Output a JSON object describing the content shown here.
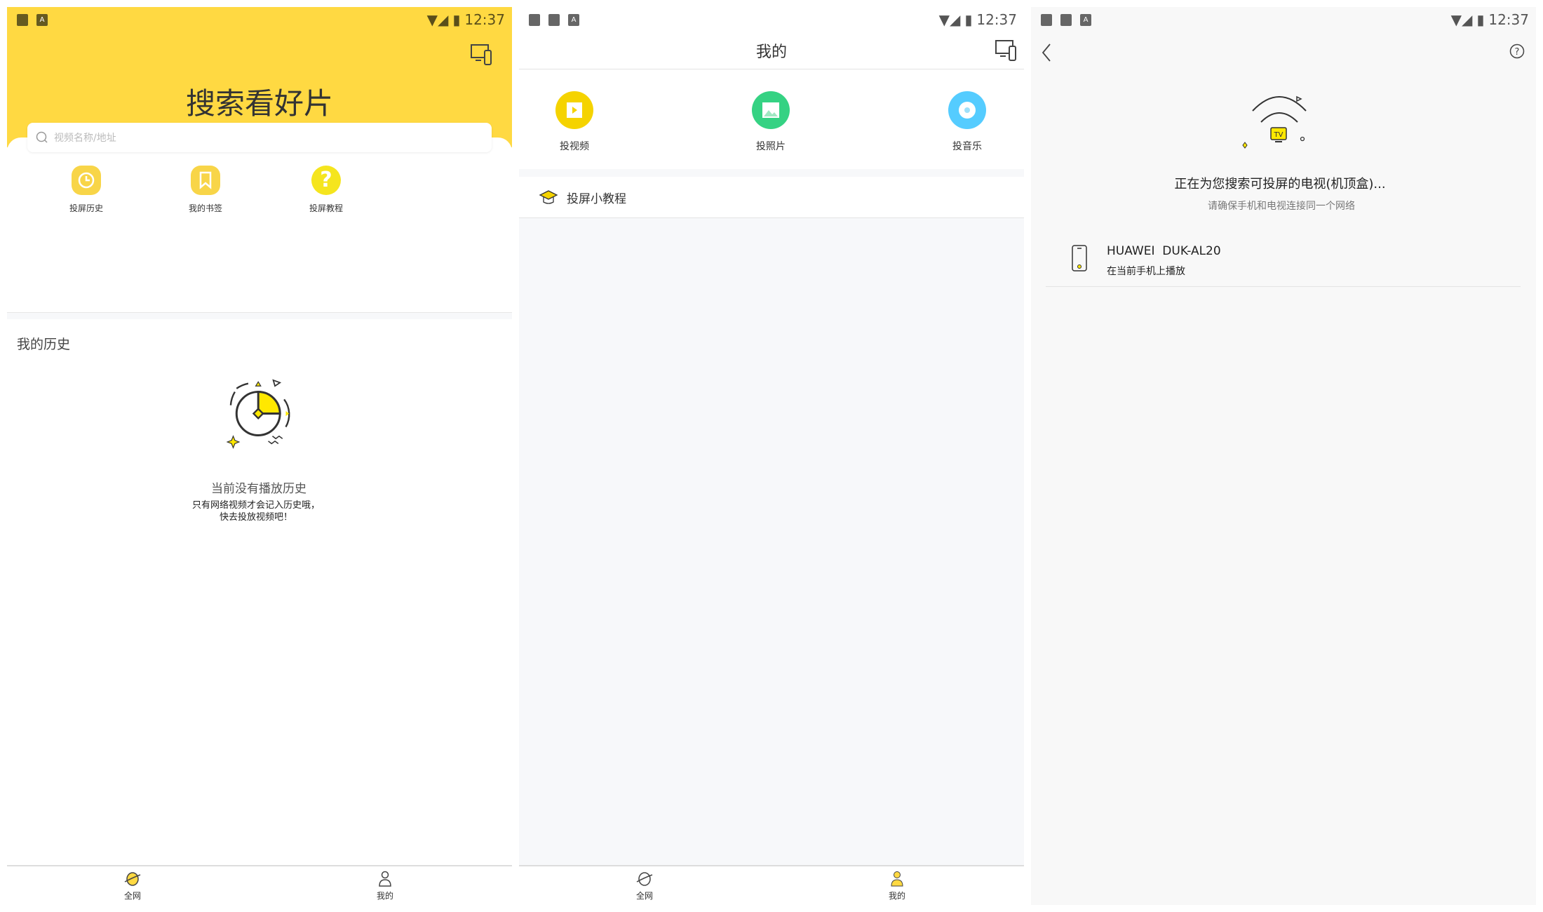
{
  "status_bar": {
    "time": "12:37"
  },
  "home": {
    "title": "搜索看好片",
    "search_placeholder": "视频名称/地址",
    "quick_actions": [
      {
        "label": "投屏历史",
        "icon": "clock-icon"
      },
      {
        "label": "我的书签",
        "icon": "bookmark-icon"
      },
      {
        "label": "投屏教程",
        "icon": "help-icon"
      }
    ],
    "history_heading": "我的历史",
    "empty_title": "当前没有播放历史",
    "empty_line1": "只有网络视频才会记入历史哦，",
    "empty_line2": "快去投放视频吧！"
  },
  "mine": {
    "title": "我的",
    "actions": [
      {
        "label": "投视频",
        "color": "#f5d300"
      },
      {
        "label": "投照片",
        "color": "#35d283"
      },
      {
        "label": "投音乐",
        "color": "#55ccff"
      }
    ],
    "tutorial_label": "投屏小教程"
  },
  "nav": {
    "items": [
      {
        "label": "全网"
      },
      {
        "label": "我的"
      }
    ]
  },
  "search": {
    "title": "正在为您搜索可投屏的电视(机顶盒)...",
    "subtitle": "请确保手机和电视连接同一个网络",
    "tv_badge": "TV",
    "device_name": "HUAWEI  DUK-AL20",
    "device_sub": "在当前手机上播放"
  },
  "colors": {
    "brand_yellow": "#ffd942",
    "page_bg": "#f7f8fa"
  }
}
